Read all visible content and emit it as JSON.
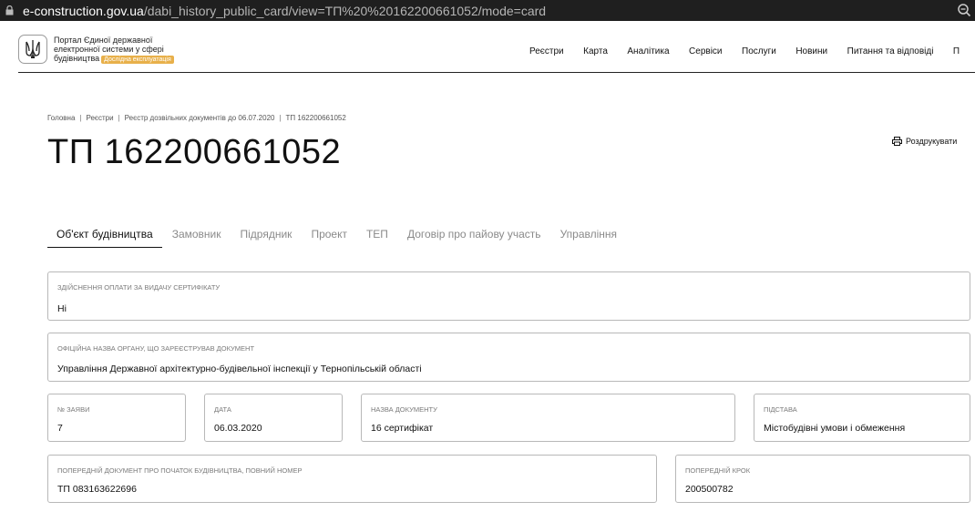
{
  "browser": {
    "url_host": "e-construction.gov.ua",
    "url_path": "/dabi_history_public_card/view=ТП%20%20162200661052/mode=card"
  },
  "header": {
    "portal_title_line1": "Портал Єдиної державної",
    "portal_title_line2": "електронної системи у сфері",
    "portal_title_line3": "будівництва",
    "badge": "Дослідна експлуатація",
    "nav": [
      "Реєстри",
      "Карта",
      "Аналітика",
      "Сервіси",
      "Послуги",
      "Новини",
      "Питання та відповіді",
      "П"
    ]
  },
  "breadcrumbs": [
    "Головна",
    "Реєстри",
    "Реєстр дозвільних документів до 06.07.2020",
    "ТП 162200661052"
  ],
  "page_title": "ТП 162200661052",
  "print_label": "Роздрукувати",
  "tabs": [
    "Об'єкт будівництва",
    "Замовник",
    "Підрядник",
    "Проект",
    "ТЕП",
    "Договір про пайову участь",
    "Управління"
  ],
  "fields": {
    "payment": {
      "label": "Здійснення оплати за видачу сертифікату",
      "value": "Ні"
    },
    "authority": {
      "label": "Офіційна назва органу, що зареєстрував документ",
      "value": "Управління Державної архітектурно-будівельної інспекції у Тернопільській області"
    },
    "app_no": {
      "label": "№ заяви",
      "value": "7"
    },
    "date": {
      "label": "Дата",
      "value": "06.03.2020"
    },
    "doc_name": {
      "label": "Назва документу",
      "value": "16 сертифікат"
    },
    "basis": {
      "label": "Підстава",
      "value": "Містобудівні умови і обмеження"
    },
    "prev_doc": {
      "label": "Попередній документ про початок будівництва, повний номер",
      "value": "ТП 083163622696"
    },
    "prev_step": {
      "label": "Попередній крок",
      "value": "200500782"
    }
  },
  "colors": {
    "badge": "#e8b04a",
    "address_bar": "#1f1f1f",
    "field_border": "#b8b8b8"
  }
}
